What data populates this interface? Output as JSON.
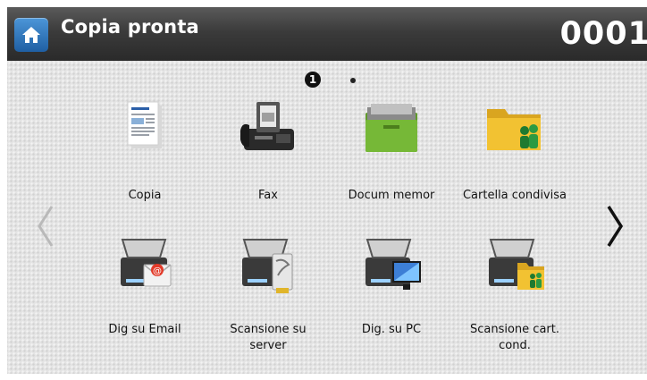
{
  "header": {
    "title": "Copia pronta",
    "counter": "0001"
  },
  "pager": {
    "current_page": "1"
  },
  "apps": [
    {
      "label": "Copia",
      "icon": "copy-document-icon"
    },
    {
      "label": "Fax",
      "icon": "fax-machine-icon"
    },
    {
      "label": "Docum memor",
      "icon": "green-folder-icon"
    },
    {
      "label": "Cartella condivisa",
      "icon": "shared-folder-icon"
    },
    {
      "label": "Dig su Email",
      "icon": "scanner-email-icon"
    },
    {
      "label": "Scansione su server",
      "icon": "scanner-server-icon"
    },
    {
      "label": "Dig. su PC",
      "icon": "scanner-pc-icon"
    },
    {
      "label": "Scansione cart. cond.",
      "icon": "scanner-shared-folder-icon"
    }
  ],
  "colors": {
    "header_bg": "#333333",
    "home_button": "#2f78c4",
    "panel_bg": "#e4e4e4"
  }
}
